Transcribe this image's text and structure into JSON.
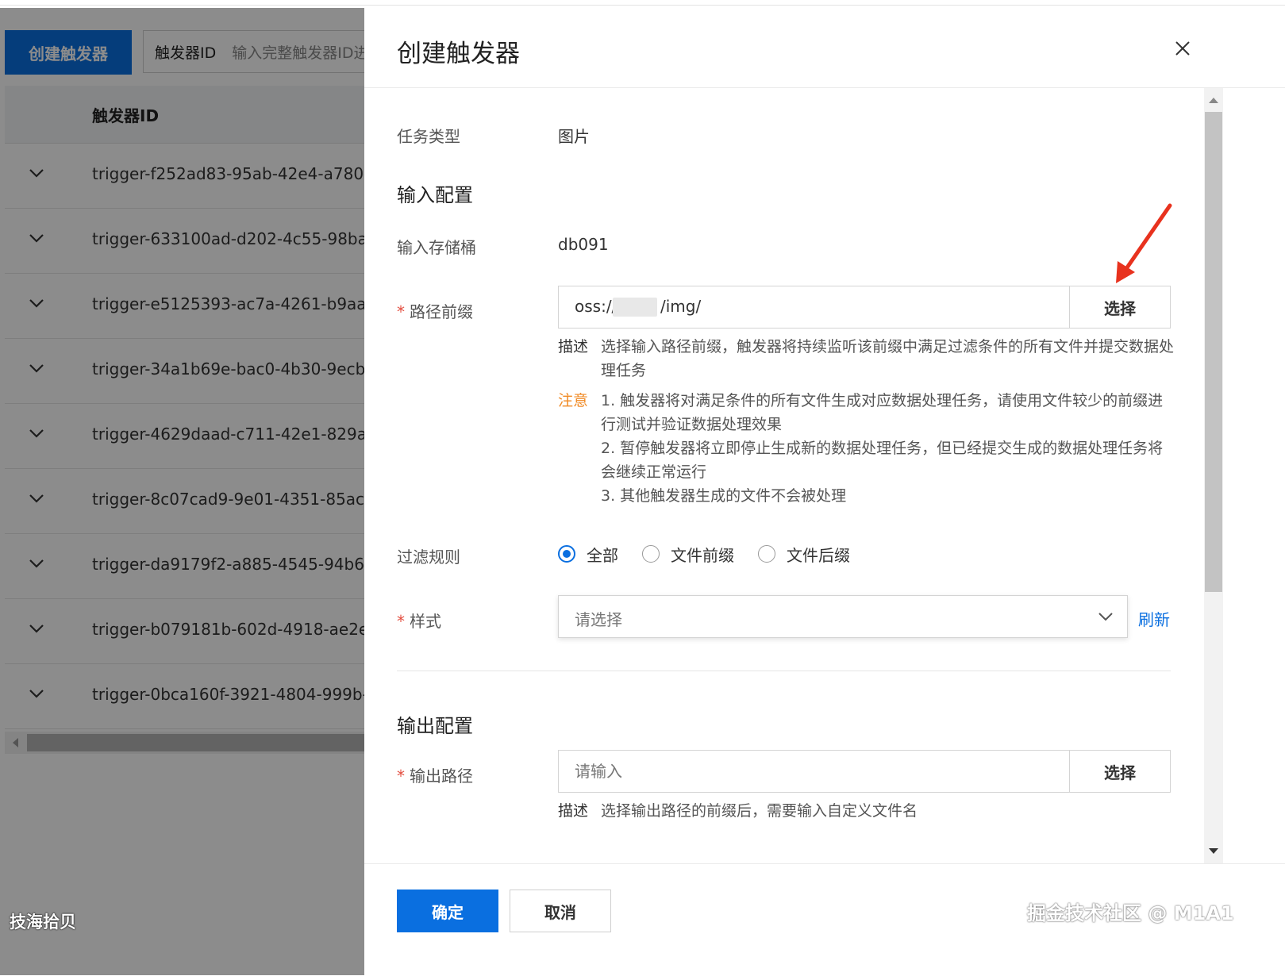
{
  "background_page": {
    "create_button": "创建触发器",
    "id_filter_label": "触发器ID",
    "id_filter_placeholder": "输入完整触发器ID进",
    "column_header": "触发器ID",
    "rows": [
      {
        "id": "trigger-f252ad83-95ab-42e4-a780-..."
      },
      {
        "id": "trigger-633100ad-d202-4c55-98ba-..."
      },
      {
        "id": "trigger-e5125393-ac7a-4261-b9aa-..."
      },
      {
        "id": "trigger-34a1b69e-bac0-4b30-9ecb-..."
      },
      {
        "id": "trigger-4629daad-c711-42e1-829a-..."
      },
      {
        "id": "trigger-8c07cad9-9e01-4351-85ac-..."
      },
      {
        "id": "trigger-da9179f2-a885-4545-94b6-..."
      },
      {
        "id": "trigger-b079181b-602d-4918-ae2e-..."
      },
      {
        "id": "trigger-0bca160f-3921-4804-999b-..."
      }
    ],
    "watermark": "技海拾贝"
  },
  "drawer": {
    "title": "创建触发器",
    "task_type_label": "任务类型",
    "task_type_value": "图片",
    "input_section_title": "输入配置",
    "bucket_label": "输入存储桶",
    "bucket_value": "db091",
    "prefix_label": "路径前缀",
    "prefix_value_start": "oss://",
    "prefix_value_end": "/img/",
    "select_button": "选择",
    "desc_tag": "描述",
    "prefix_desc": "选择输入路径前缀，触发器将持续监听该前缀中满足过滤条件的所有文件并提交数据处理任务",
    "note_tag": "注意",
    "notes": [
      "1. 触发器将对满足条件的所有文件生成对应数据处理任务，请使用文件较少的前缀进行测试并验证数据处理效果",
      "2. 暂停触发器将立即停止生成新的数据处理任务，但已经提交生成的数据处理任务将会继续正常运行",
      "3. 其他触发器生成的文件不会被处理"
    ],
    "filter_label": "过滤规则",
    "filter_options": [
      "全部",
      "文件前缀",
      "文件后缀"
    ],
    "filter_selected": "全部",
    "style_label": "样式",
    "style_placeholder": "请选择",
    "refresh_link": "刷新",
    "output_section_title": "输出配置",
    "output_path_label": "输出路径",
    "output_placeholder": "请输入",
    "output_select_button": "选择",
    "output_desc": "选择输出路径的前缀后，需要输入自定义文件名",
    "confirm_button": "确定",
    "cancel_button": "取消",
    "watermark": "掘金技术社区 @ M1A1"
  },
  "colors": {
    "primary": "#0a6fe0",
    "warning": "#f08a24",
    "required": "#e34d3f",
    "arrow": "#e8321e"
  }
}
